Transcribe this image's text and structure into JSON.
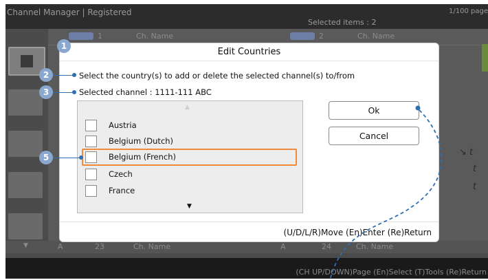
{
  "topbar": {
    "title": "Channel Manager | Registered",
    "selected": "Selected items : 2",
    "page": "1/100 page"
  },
  "grid": {
    "header_left": {
      "num": "1",
      "name": "Ch. Name"
    },
    "header_right": {
      "num": "2",
      "name": "Ch. Name"
    },
    "bottom_left": {
      "tag": "A",
      "num": "23",
      "name": "Ch. Name"
    },
    "bottom_right": {
      "tag": "A",
      "num": "24",
      "name": "Ch. Name"
    },
    "scroll_down": "▼",
    "right_marks": [
      "↘ t",
      "t",
      "t"
    ]
  },
  "bottombar": {
    "hint": "(CH UP/DOWN)Page  (En)Select  (T)Tools  (Re)Return"
  },
  "dialog": {
    "title": "Edit Countries",
    "instruction": "Select the country(s) to add or delete the selected channel(s) to/from",
    "selected_channel": "Selected channel : 1111-111 ABC",
    "countries": [
      {
        "label": "Austria",
        "checked": false
      },
      {
        "label": "Belgium (Dutch)",
        "checked": false
      },
      {
        "label": "Belgium (French)",
        "checked": false,
        "focused": true
      },
      {
        "label": "Czech",
        "checked": false
      },
      {
        "label": "France",
        "checked": false
      }
    ],
    "scroll_up": "▲",
    "scroll_down": "▼",
    "ok_label": "Ok",
    "cancel_label": "Cancel",
    "footer_hint": "(U/D/L/R)Move  (En)Enter  (Re)Return"
  },
  "callouts": [
    "1",
    "2",
    "3",
    "5"
  ],
  "colors": {
    "tv_background": "#4b4b4b",
    "dialog_background": "#ffffff",
    "focus_border": "#f08a3a",
    "callout_fill": "#8aa7cf",
    "leader_line": "#2f6fb0"
  }
}
